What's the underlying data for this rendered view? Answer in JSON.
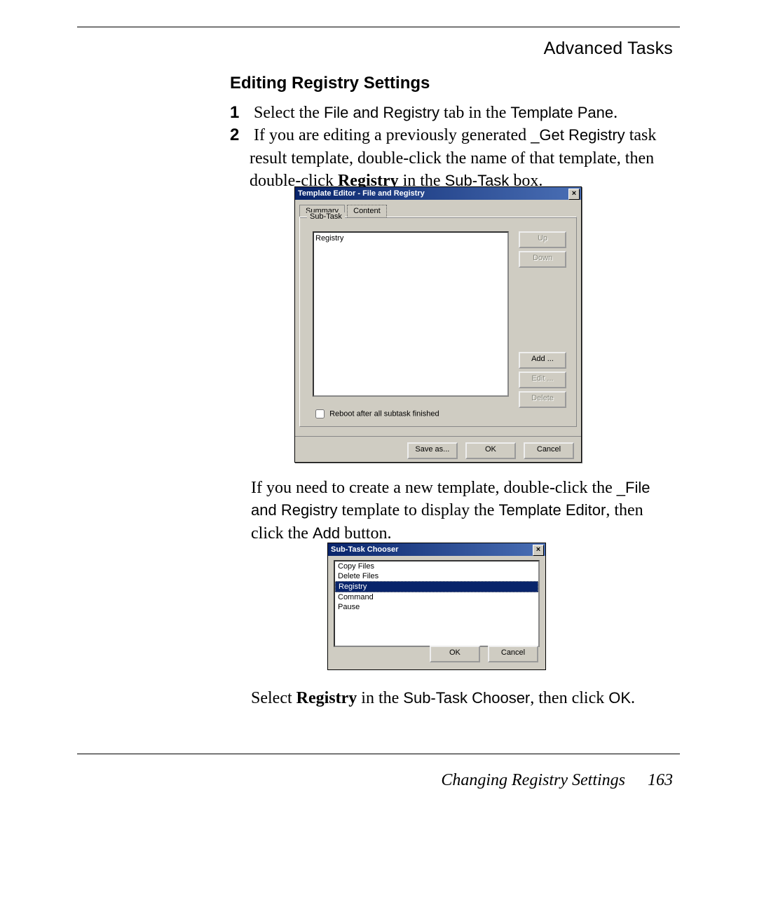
{
  "header": {
    "right": "Advanced Tasks"
  },
  "section_title": "Editing Registry Settings",
  "steps": {
    "n1": "1",
    "s1_a": "Select the ",
    "s1_b": "File and Registry",
    "s1_c": " tab in the ",
    "s1_d": "Template Pane",
    "s1_e": ".",
    "n2": "2",
    "s2_a": "If you are editing a previously generated ",
    "s2_b": "_Get Registry",
    "s2_c": " task result template, double-click the name of that template, then double-click ",
    "s2_d": "Registry",
    "s2_e": " in the ",
    "s2_f": "Sub-Task",
    "s2_g": " box."
  },
  "dlg1": {
    "title": "Template Editor - File and Registry",
    "tab_summary": "Summary",
    "tab_content": "Content",
    "group_label": "Sub-Task",
    "list_item": "Registry",
    "btn_up": "Up",
    "btn_down": "Down",
    "btn_add": "Add ...",
    "btn_edit": "Edit ...",
    "btn_delete": "Delete",
    "chk_label": "Reboot after all subtask finished",
    "btn_saveas": "Save as...",
    "btn_ok": "OK",
    "btn_cancel": "Cancel"
  },
  "para2": {
    "a": "If you need to create a new template, double-click the ",
    "b": "_File and Registry",
    "c": " template to display the ",
    "d": "Template Editor",
    "e": ", then click the ",
    "f": "Add",
    "g": " button."
  },
  "dlg2": {
    "title": "Sub-Task Chooser",
    "items": {
      "i0": "Copy Files",
      "i1": "Delete Files",
      "i2": "Registry",
      "i3": "Command",
      "i4": "Pause"
    },
    "btn_ok": "OK",
    "btn_cancel": "Cancel"
  },
  "para3": {
    "a": "Select ",
    "b": "Registry",
    "c": " in the ",
    "d": "Sub-Task Chooser",
    "e": ", then click ",
    "f": "OK",
    "g": "."
  },
  "footer": {
    "title": "Changing Registry Settings",
    "page": "163"
  }
}
